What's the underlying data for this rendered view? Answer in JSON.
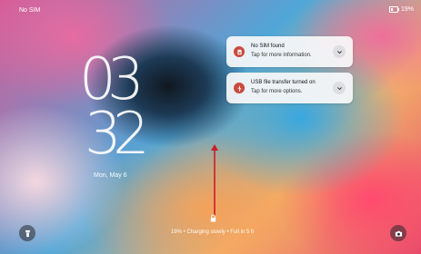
{
  "status_bar": {
    "carrier": "No SIM",
    "battery": "19%"
  },
  "clock": {
    "hour_tens": "0",
    "hour_ones": "3",
    "minute_tens": "3",
    "minute_ones": "2"
  },
  "date": "Mon, May 6",
  "notifications": [
    {
      "title": "No SIM found",
      "body": "Tap for more information.",
      "icon": "sim-icon",
      "expand_icon": "chevron-down-icon"
    },
    {
      "title": "USB file transfer turned on",
      "body": "Tap for more options.",
      "icon": "usb-icon",
      "expand_icon": "chevron-down-icon"
    }
  ],
  "charging_status": "19% • Charging slowly • Full in 5 h",
  "shortcuts": {
    "left_icon": "flashlight-icon",
    "right_icon": "camera-icon"
  },
  "colors": {
    "notification_icon_bg": "#c94a3c",
    "swipe_arrow": "#c81e2a"
  }
}
